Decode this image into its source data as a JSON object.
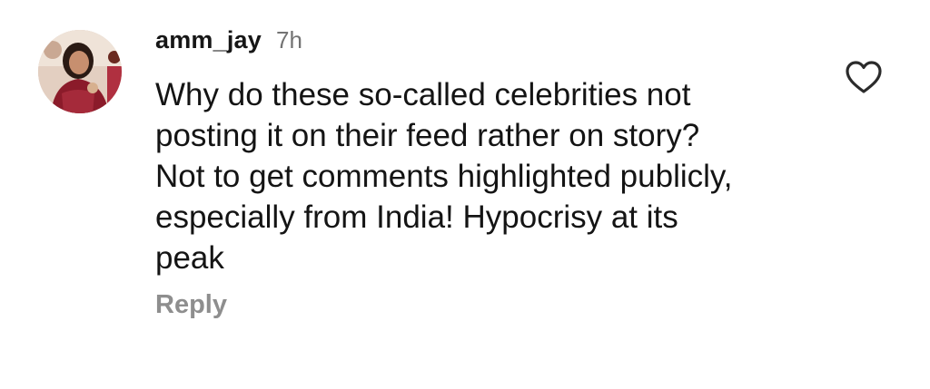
{
  "comment": {
    "author": {
      "username": "amm_jay",
      "avatar_icon": "profile-photo"
    },
    "timestamp": "7h",
    "text": "Why do these so-called celebrities not\nposting it on their feed rather on story?\nNot to get comments highlighted publicly,\nespecially from India! Hypocrisy at its\npeak",
    "reply_label": "Reply",
    "like_icon": "heart-outline-icon"
  },
  "colors": {
    "text_primary": "#141414",
    "text_secondary": "#737373",
    "reply_gray": "#8e8e8e"
  }
}
